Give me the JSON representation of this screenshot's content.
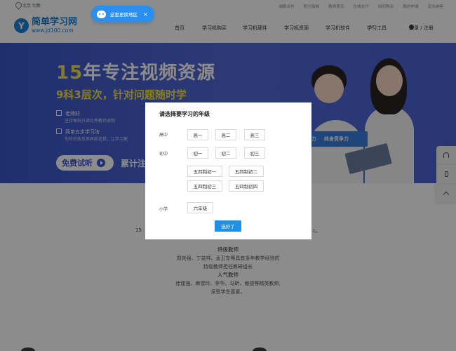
{
  "topbar": {
    "location": "北京 切换",
    "links": [
      "诚聘合作",
      "积分商城",
      "教师意见",
      "在线支付",
      "如何购买",
      "我的申请",
      "定向讲座"
    ]
  },
  "toast": {
    "text": "这里更换地区",
    "close": "×"
  },
  "logo": {
    "mark": "Y",
    "name": "简单学习网",
    "url": "www.jd100.com"
  },
  "nav": {
    "items": [
      "首页",
      "学习机购买",
      "学习机硬件",
      "学习机资源",
      "学习机软件",
      "学习工具"
    ],
    "login": "登录 / 注册"
  },
  "banner": {
    "title_num": "15",
    "title_rest": "年专注视频资源",
    "subtitle": "9科3层次，针对问题随时学",
    "item1_head": "老师好",
    "item1_desc": "坚持每科只请优秀教师录制",
    "item2_head": "简单五步学习法",
    "item2_desc": "先听后练反思再练追错，让学习更",
    "button": "免费试听",
    "count": "累计注",
    "tag": "终身竞争力",
    "tag2": "力"
  },
  "content": {
    "left_frag": "15",
    "right_frag": "c。",
    "teacher_head1": "特级教师",
    "teacher_line1": "郑克强、丁益祥、孟卫东等具有多年教学经验的",
    "teacher_line2": "特级教师担任教研组长",
    "teacher_head2": "人气教师",
    "teacher_line3": "徐建强、麻雪玲、李华、马昕、傲德等精英教师,",
    "teacher_line4": "深受学生喜爱。"
  },
  "modal": {
    "title": "请选择要学习的年级",
    "groups": {
      "gaozhong": {
        "label": "高中",
        "options": [
          "高一",
          "高二",
          "高三"
        ]
      },
      "chuzhong": {
        "label": "初中",
        "options": [
          "初一",
          "初二",
          "初三",
          "五四制初一",
          "五四制初二",
          "五四制初三",
          "五四制初四"
        ]
      },
      "xiaoxue": {
        "label": "小学",
        "options": [
          "六年级"
        ]
      }
    },
    "confirm": "选好了"
  },
  "colors": {
    "brand": "#1a83d8",
    "banner": "#4a63d4",
    "confirm": "#1e90e8",
    "accent_yellow": "#f4e04c"
  }
}
